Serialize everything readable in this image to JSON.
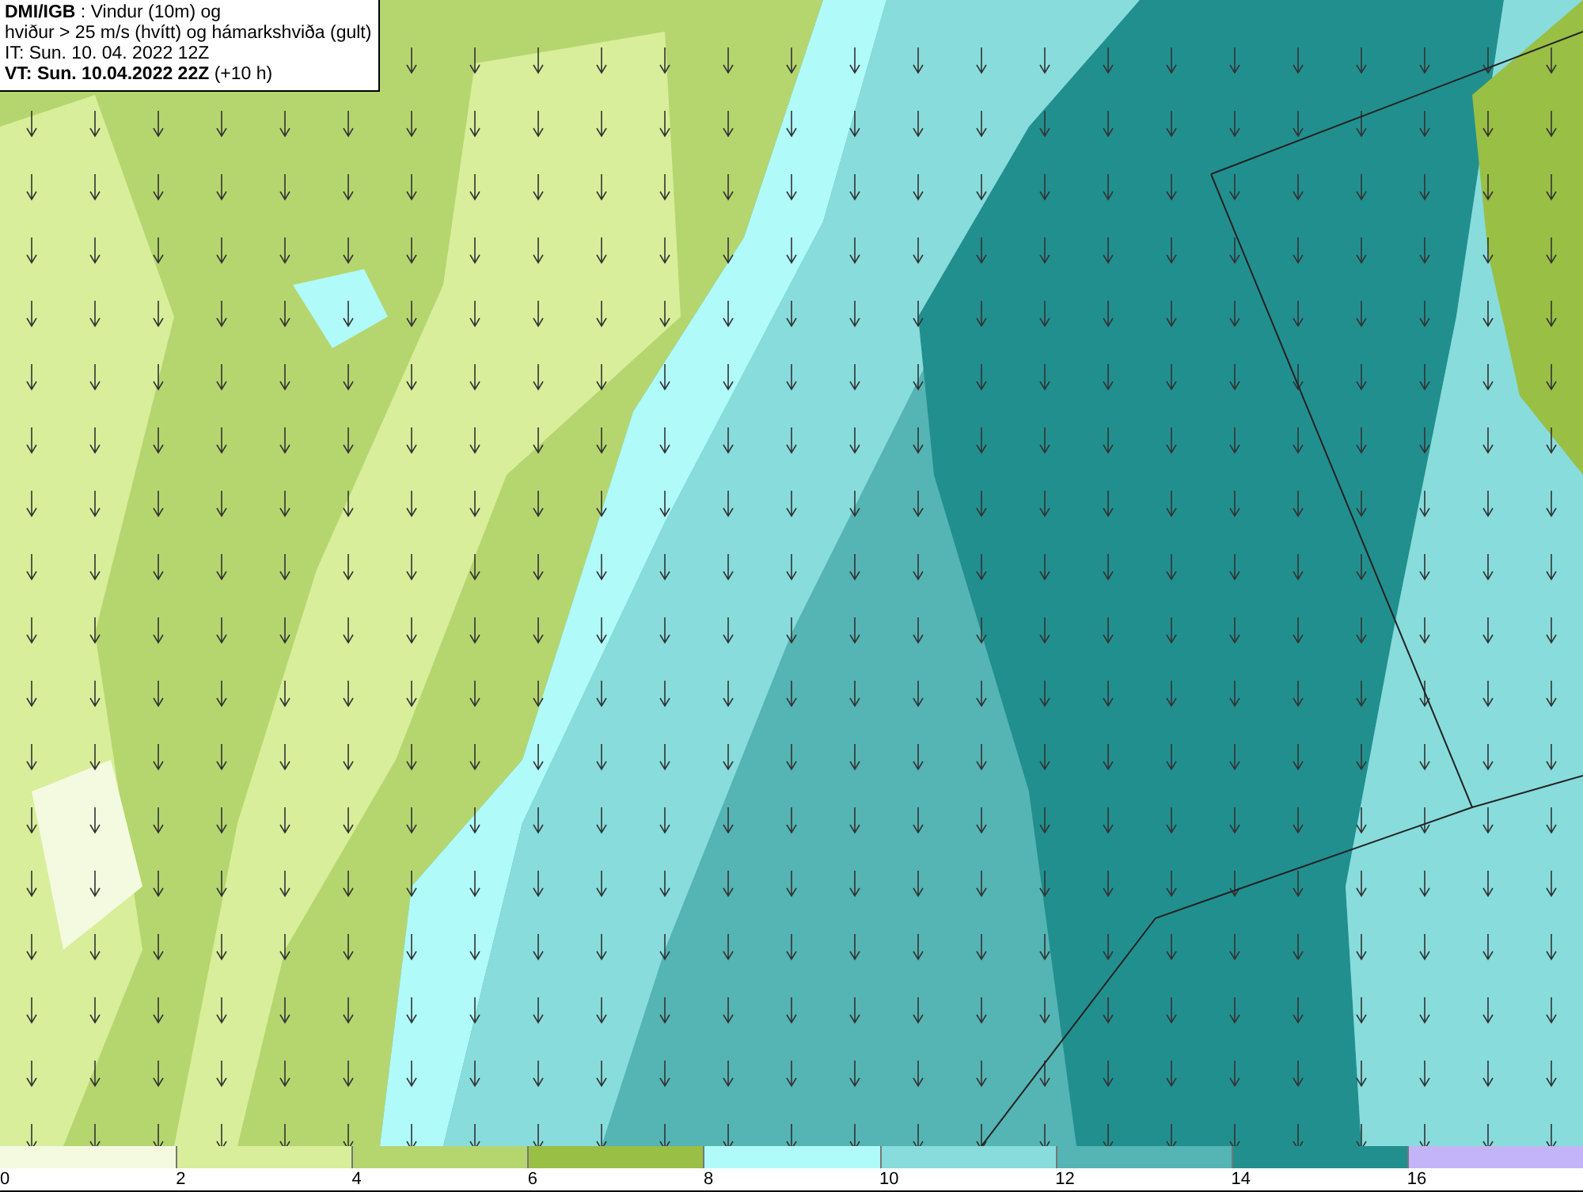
{
  "title_box": {
    "lines": [
      "**DMI/IGB** : Vindur (10m) og",
      "hviður > 25 m/s (hvítt) og hámarkshviða (gult)",
      "IT: Sun. 10. 04. 2022 12Z",
      "**VT: Sun. 10.04.2022 22Z** (+10 h)"
    ]
  },
  "legend": {
    "segments": [
      {
        "color": "#f4fadf"
      },
      {
        "color": "#d8ee9a"
      },
      {
        "color": "#b5d66e"
      },
      {
        "color": "#99bf45"
      },
      {
        "color": "#b0fafa"
      },
      {
        "color": "#88dcdc"
      },
      {
        "color": "#55b4b4"
      },
      {
        "color": "#228f8f"
      },
      {
        "color": "#c3b4f8"
      }
    ],
    "ticks": [
      "0",
      "2",
      "4",
      "6",
      "8",
      "10",
      "12",
      "14",
      "16"
    ]
  }
}
